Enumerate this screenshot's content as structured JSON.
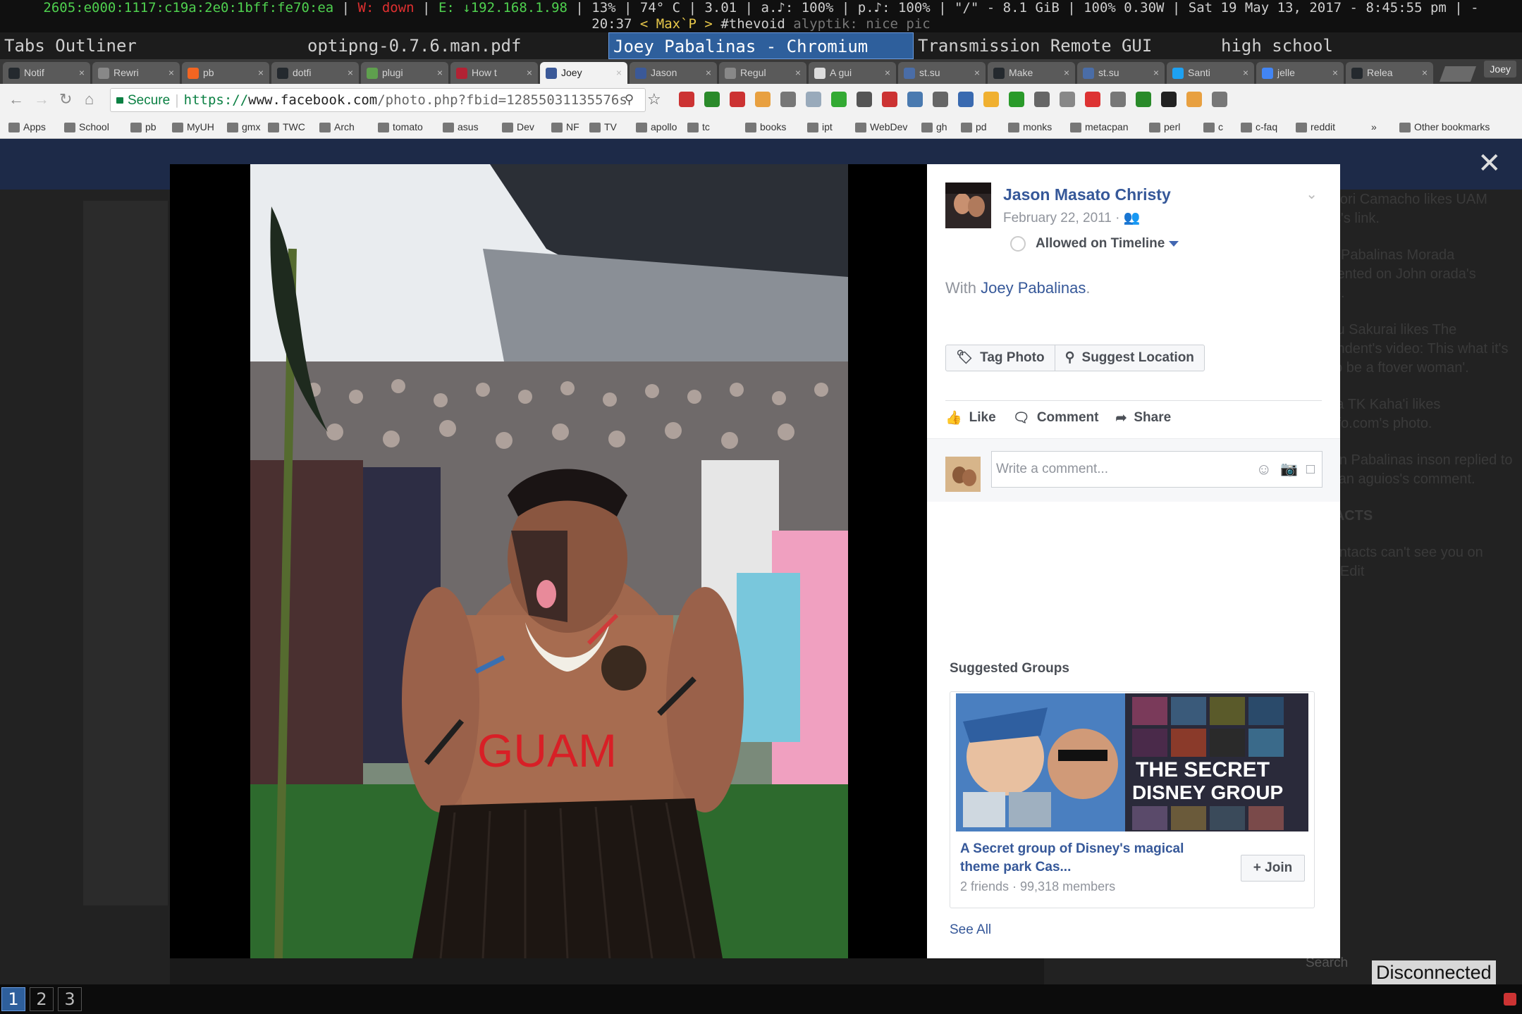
{
  "statusbar": {
    "line1": {
      "ipv6": "2605:e000:1117:c19a:2e0:1bff:fe70:ea",
      "wifi": "W: down",
      "eth": "E: ↓192.168.1.98",
      "rest": "13% | 74° C | 3.01 | a.♪: 100% | p.♪: 100% | \"/\" - 8.1 GiB | 100% 0.30W | Sat 19 May 13, 2017 -  8:45:55 pm | -"
    },
    "line2": {
      "time": "20:37",
      "max": "< Max`P >",
      "channel": "#thevoid",
      "msg": "alyptik: nice pic"
    }
  },
  "wm_titles": [
    "Tabs Outliner",
    "optipng-0.7.6.man.pdf",
    "Joey Pabalinas - Chromium",
    "Transmission Remote GUI",
    "high school"
  ],
  "tabs": [
    {
      "label": "Notif",
      "color": "#24292e"
    },
    {
      "label": "Rewri",
      "color": "#888888"
    },
    {
      "label": "pb",
      "color": "#f26522"
    },
    {
      "label": "dotfi",
      "color": "#24292e"
    },
    {
      "label": "plugi",
      "color": "#5fa04e"
    },
    {
      "label": "How t",
      "color": "#b22234"
    },
    {
      "label": "Joey",
      "color": "#3b5998"
    },
    {
      "label": "Jason",
      "color": "#3b5998"
    },
    {
      "label": "Regul",
      "color": "#888888"
    },
    {
      "label": "A gui",
      "color": "#dddddd"
    },
    {
      "label": "st.su",
      "color": "#4a6da7"
    },
    {
      "label": "Make",
      "color": "#24292e"
    },
    {
      "label": "st.su",
      "color": "#4a6da7"
    },
    {
      "label": "Santi",
      "color": "#1da1f2"
    },
    {
      "label": "jelle",
      "color": "#4285f4"
    },
    {
      "label": "Relea",
      "color": "#24292e"
    }
  ],
  "active_tab_index": 6,
  "profile": "Joey",
  "omnibox": {
    "secure": "Secure",
    "protocol": "https://",
    "host": "www.facebook.com",
    "path": "/photo.php?fbid=12855031135576s"
  },
  "bookmarks": [
    "Apps",
    "School",
    "pb",
    "MyUH",
    "gmx",
    "TWC",
    "Arch",
    "tomato",
    "asus",
    "Dev",
    "NF",
    "TV",
    "apollo",
    "tc",
    "books",
    "ipt",
    "WebDev",
    "gh",
    "pd",
    "monks",
    "metacpan",
    "perl",
    "c",
    "c-faq",
    "reddit",
    "»",
    "Other bookmarks"
  ],
  "photo": {
    "belly_text": "GUAM"
  },
  "post": {
    "author": "Jason Masato Christy",
    "date": "February 22, 2011 ·",
    "timeline_label": "Allowed on Timeline",
    "with_prefix": "With ",
    "with_name": "Joey Pabalinas",
    "with_suffix": ".",
    "tag_photo": "Tag Photo",
    "suggest_location": "Suggest Location",
    "like": "Like",
    "comment": "Comment",
    "share": "Share",
    "comment_placeholder": "Write a comment..."
  },
  "suggested_groups": {
    "title": "Suggested Groups",
    "banner_text_1": "THE SECRET",
    "banner_text_2": "DISNEY GROUP",
    "name": "A Secret group of Disney's magical theme park Cas...",
    "meta": "2 friends · 99,318 members",
    "join": "Join",
    "see_all": "See All"
  },
  "background_feed": [
    "eterCori Camacho likes UAM News's link.",
    "enen Pabalinas Morada ommented on John orada's photo.",
    "anabu Sakurai likes The dependent's video: This what it's like to be a ftover woman'.",
    "oshua TK Kaha'i likes annafo.com's photo.",
    "onalyn Pabalinas inson replied to Rhayan aguios's comment.",
    "ONTACTS",
    "se contacts can't see you on chat. Edit"
  ],
  "chat_search": "Search",
  "disconnected": "Disconnected",
  "workspaces": [
    "1",
    "2",
    "3"
  ],
  "colors": {
    "fb_blue": "#365899",
    "secure_green": "#0b8043",
    "active_wm": "#2e5f9c"
  }
}
